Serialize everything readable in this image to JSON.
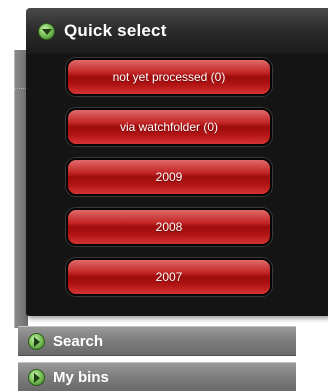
{
  "quick_select": {
    "title": "Quick select",
    "toggle_icon": "collapse-arrow-icon",
    "buttons": [
      {
        "label": "not yet processed (0)"
      },
      {
        "label": "via watchfolder (0)"
      },
      {
        "label": "2009"
      },
      {
        "label": "2008"
      },
      {
        "label": "2007"
      }
    ]
  },
  "accordion": {
    "search_label": "Search",
    "bins_label": "My bins",
    "expand_icon": "expand-arrow-icon"
  },
  "colors": {
    "button_red": "#b11414",
    "panel_dark": "#141414",
    "accordion_gray": "#7c7c7c",
    "icon_green": "#7cc45a"
  }
}
